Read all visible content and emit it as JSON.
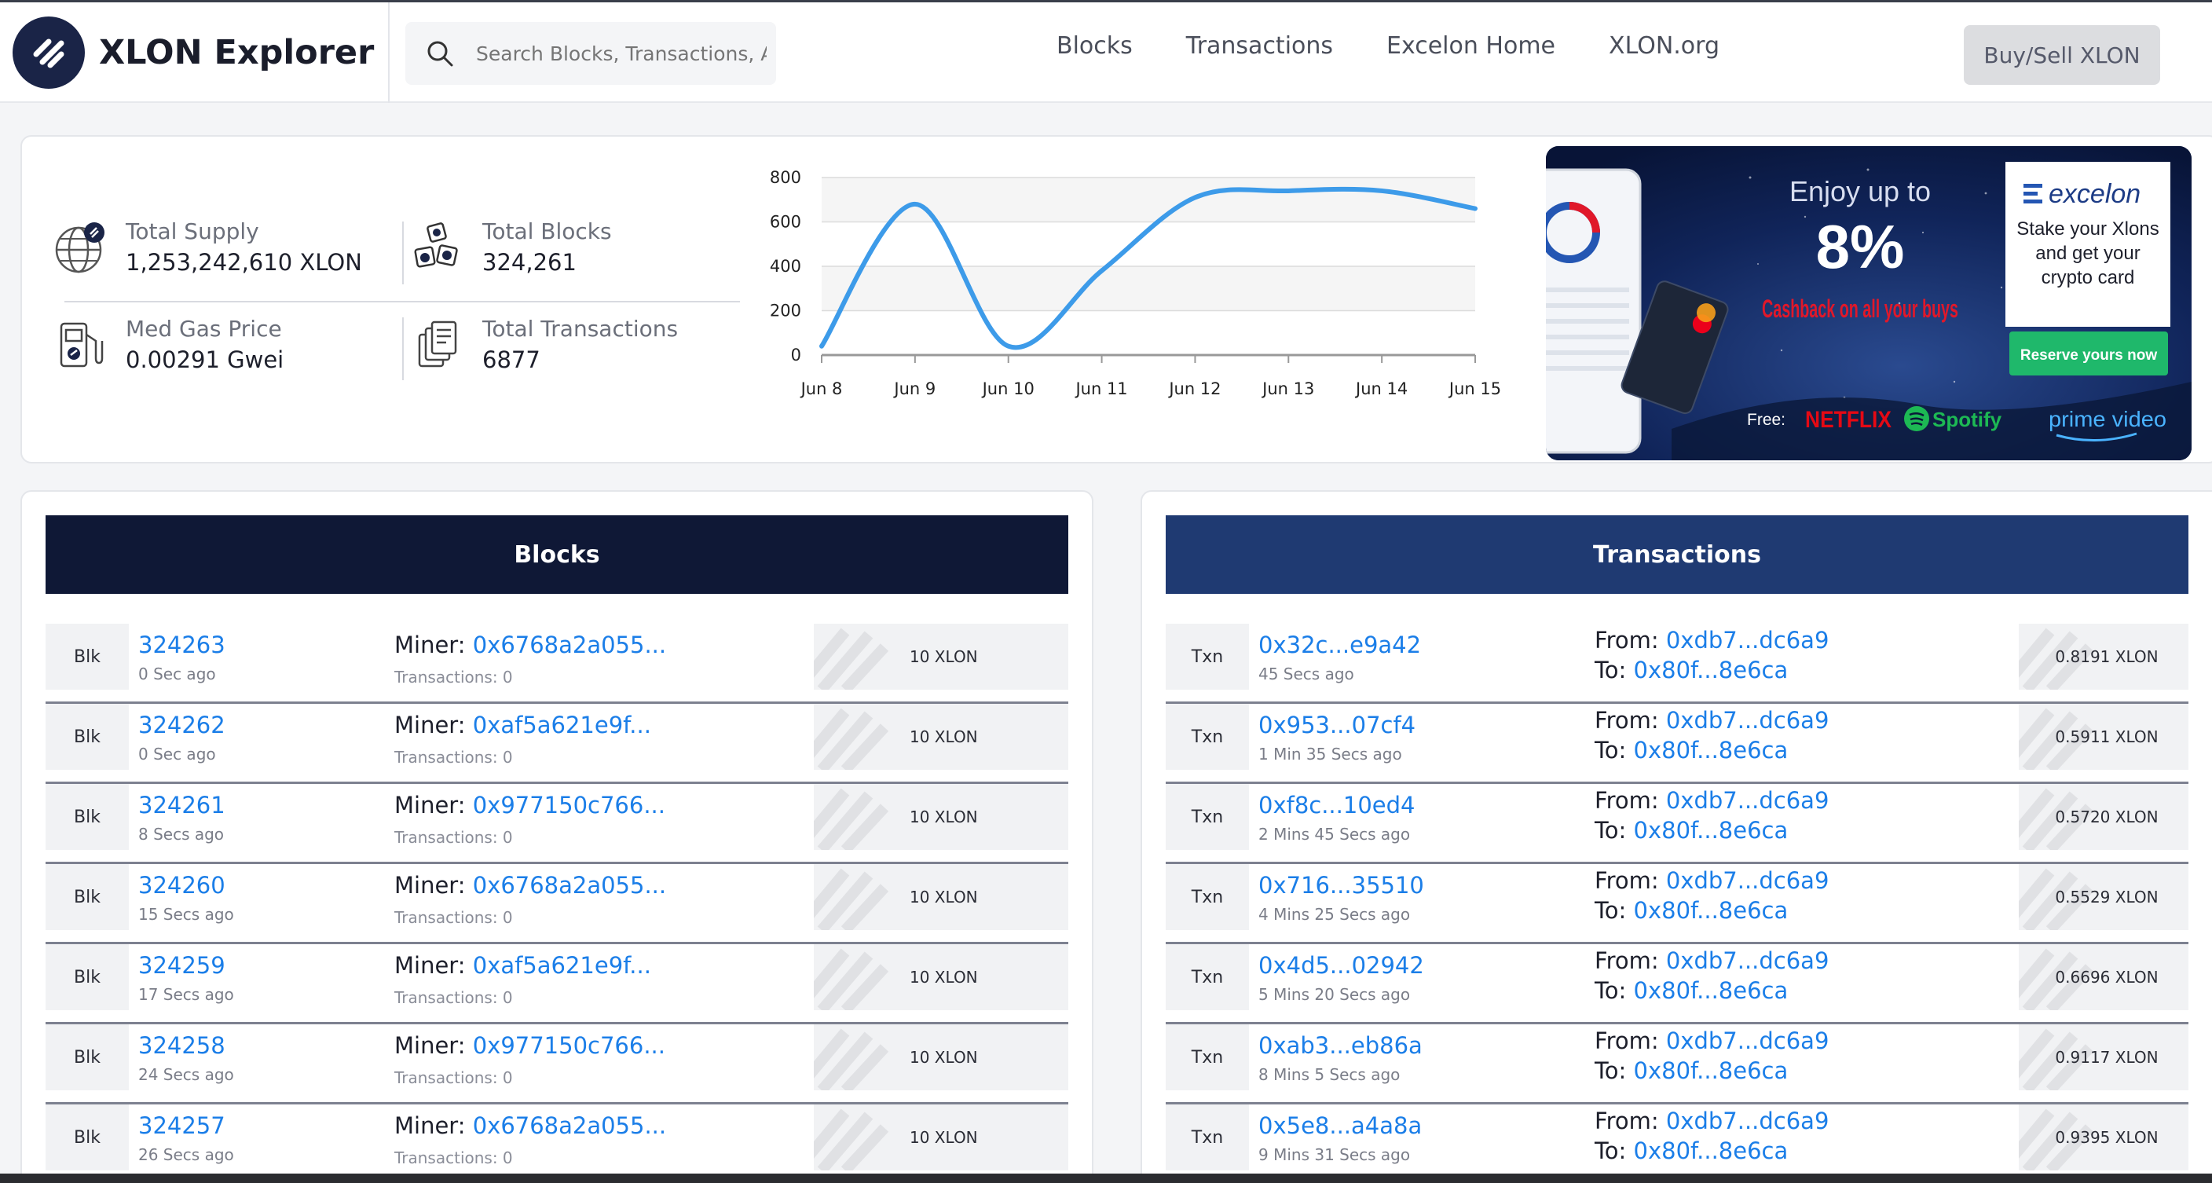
{
  "header": {
    "brand": "XLON Explorer",
    "search_placeholder": "Search Blocks, Transactions, Addresses",
    "nav": [
      "Blocks",
      "Transactions",
      "Excelon Home",
      "XLON.org"
    ],
    "buy_label": "Buy/Sell XLON"
  },
  "stats": {
    "supply_label": "Total Supply",
    "supply_value": "1,253,242,610 XLON",
    "blocks_label": "Total Blocks",
    "blocks_value": "324,261",
    "gas_label": "Med Gas Price",
    "gas_value": "0.00291 Gwei",
    "tx_label": "Total Transactions",
    "tx_value": "6877"
  },
  "chart_data": {
    "type": "line",
    "categories": [
      "Jun 8",
      "Jun 9",
      "Jun 10",
      "Jun 11",
      "Jun 12",
      "Jun 13",
      "Jun 14",
      "Jun 15"
    ],
    "values": [
      40,
      680,
      40,
      380,
      710,
      740,
      740,
      660
    ],
    "yticks": [
      0,
      200,
      400,
      600,
      800
    ],
    "ylim": [
      0,
      800
    ],
    "color": "#3d9be9",
    "grid": true
  },
  "promo": {
    "headline": "Enjoy up to",
    "percent": "8%",
    "cashback": "Cashback on all your buys",
    "brand": "excelon",
    "stake_text": "Stake your Xlons and get your crypto card",
    "reserve_label": "Reserve yours now",
    "free_label": "Free:",
    "partners": [
      "NETFLIX",
      "Spotify",
      "prime video"
    ],
    "colors": {
      "bg": "#0d1e4d",
      "accent": "#1fb86b",
      "red": "#e0182a"
    }
  },
  "blocks": {
    "title": "Blocks",
    "tag": "Blk",
    "miner_label": "Miner:",
    "items": [
      {
        "number": "324263",
        "age": "0 Sec ago",
        "miner": "0x6768a2a055...",
        "txs": "Transactions: 0",
        "reward": "10 XLON"
      },
      {
        "number": "324262",
        "age": "0 Sec ago",
        "miner": "0xaf5a621e9f...",
        "txs": "Transactions: 0",
        "reward": "10 XLON"
      },
      {
        "number": "324261",
        "age": "8 Secs ago",
        "miner": "0x977150c766...",
        "txs": "Transactions: 0",
        "reward": "10 XLON"
      },
      {
        "number": "324260",
        "age": "15 Secs ago",
        "miner": "0x6768a2a055...",
        "txs": "Transactions: 0",
        "reward": "10 XLON"
      },
      {
        "number": "324259",
        "age": "17 Secs ago",
        "miner": "0xaf5a621e9f...",
        "txs": "Transactions: 0",
        "reward": "10 XLON"
      },
      {
        "number": "324258",
        "age": "24 Secs ago",
        "miner": "0x977150c766...",
        "txs": "Transactions: 0",
        "reward": "10 XLON"
      },
      {
        "number": "324257",
        "age": "26 Secs ago",
        "miner": "0x6768a2a055...",
        "txs": "Transactions: 0",
        "reward": "10 XLON"
      }
    ]
  },
  "transactions": {
    "title": "Transactions",
    "tag": "Txn",
    "from_label": "From:",
    "to_label": "To:",
    "items": [
      {
        "hash": "0x32c...e9a42",
        "age": "45 Secs ago",
        "from": "0xdb7...dc6a9",
        "to": "0x80f...8e6ca",
        "value": "0.8191 XLON"
      },
      {
        "hash": "0x953...07cf4",
        "age": "1 Min 35 Secs ago",
        "from": "0xdb7...dc6a9",
        "to": "0x80f...8e6ca",
        "value": "0.5911 XLON"
      },
      {
        "hash": "0xf8c...10ed4",
        "age": "2 Mins 45 Secs ago",
        "from": "0xdb7...dc6a9",
        "to": "0x80f...8e6ca",
        "value": "0.5720 XLON"
      },
      {
        "hash": "0x716...35510",
        "age": "4 Mins 25 Secs ago",
        "from": "0xdb7...dc6a9",
        "to": "0x80f...8e6ca",
        "value": "0.5529 XLON"
      },
      {
        "hash": "0x4d5...02942",
        "age": "5 Mins 20 Secs ago",
        "from": "0xdb7...dc6a9",
        "to": "0x80f...8e6ca",
        "value": "0.6696 XLON"
      },
      {
        "hash": "0xab3...eb86a",
        "age": "8 Mins 5 Secs ago",
        "from": "0xdb7...dc6a9",
        "to": "0x80f...8e6ca",
        "value": "0.9117 XLON"
      },
      {
        "hash": "0x5e8...a4a8a",
        "age": "9 Mins 31 Secs ago",
        "from": "0xdb7...dc6a9",
        "to": "0x80f...8e6ca",
        "value": "0.9395 XLON"
      }
    ]
  }
}
